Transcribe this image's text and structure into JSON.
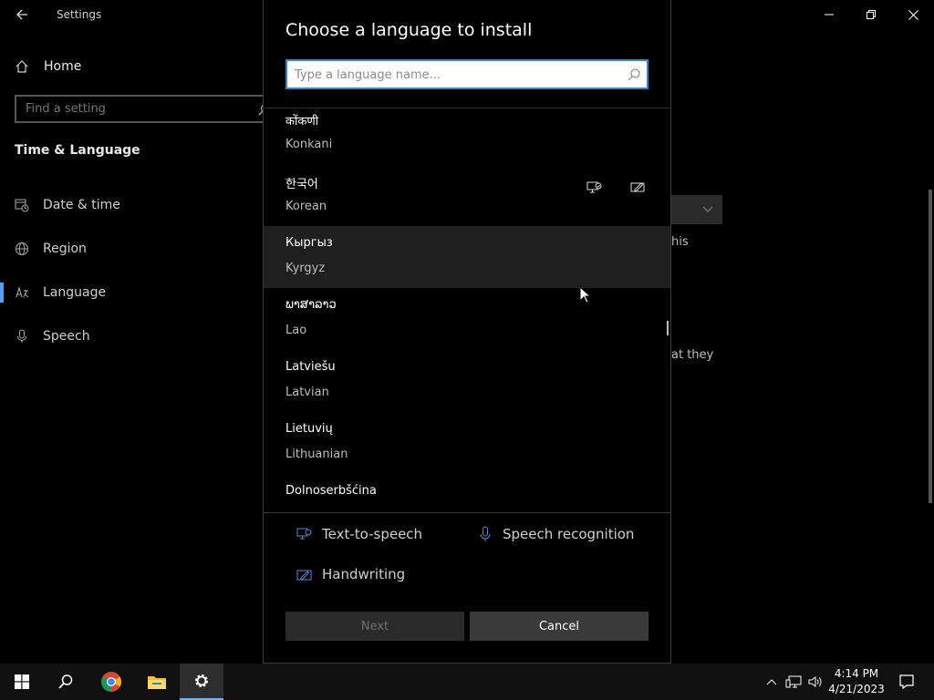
{
  "settings": {
    "title": "Settings",
    "home_label": "Home",
    "find_placeholder": "Find a setting",
    "section_title": "Time & Language",
    "nav": [
      {
        "label": "Date & time",
        "icon": "calendar-clock-icon"
      },
      {
        "label": "Region",
        "icon": "globe-icon"
      },
      {
        "label": "Language",
        "icon": "language-icon",
        "active": true
      },
      {
        "label": "Speech",
        "icon": "microphone-icon"
      }
    ],
    "background_text_1": "his",
    "background_text_2": "at they"
  },
  "dialog": {
    "title": "Choose a language to install",
    "search_placeholder": "Type a language name...",
    "languages": [
      {
        "native": "कोंकणी",
        "english": "Konkani"
      },
      {
        "native": "한국어",
        "english": "Korean",
        "features": [
          "text-to-speech-icon",
          "handwriting-icon"
        ]
      },
      {
        "native": "Кыргыз",
        "english": "Kyrgyz",
        "hovered": true
      },
      {
        "native": "ພາສາລາວ",
        "english": "Lao"
      },
      {
        "native": "Latviešu",
        "english": "Latvian"
      },
      {
        "native": "Lietuvių",
        "english": "Lithuanian"
      },
      {
        "native": "Dolnoserbšćina",
        "english": ""
      }
    ],
    "legend": {
      "tts": "Text-to-speech",
      "speech": "Speech recognition",
      "handwriting": "Handwriting"
    },
    "next_label": "Next",
    "cancel_label": "Cancel"
  },
  "taskbar": {
    "time": "4:14 PM",
    "date": "4/21/2023"
  },
  "colors": {
    "accent": "#2f86d6",
    "nav_active": "#4aa3ff"
  }
}
